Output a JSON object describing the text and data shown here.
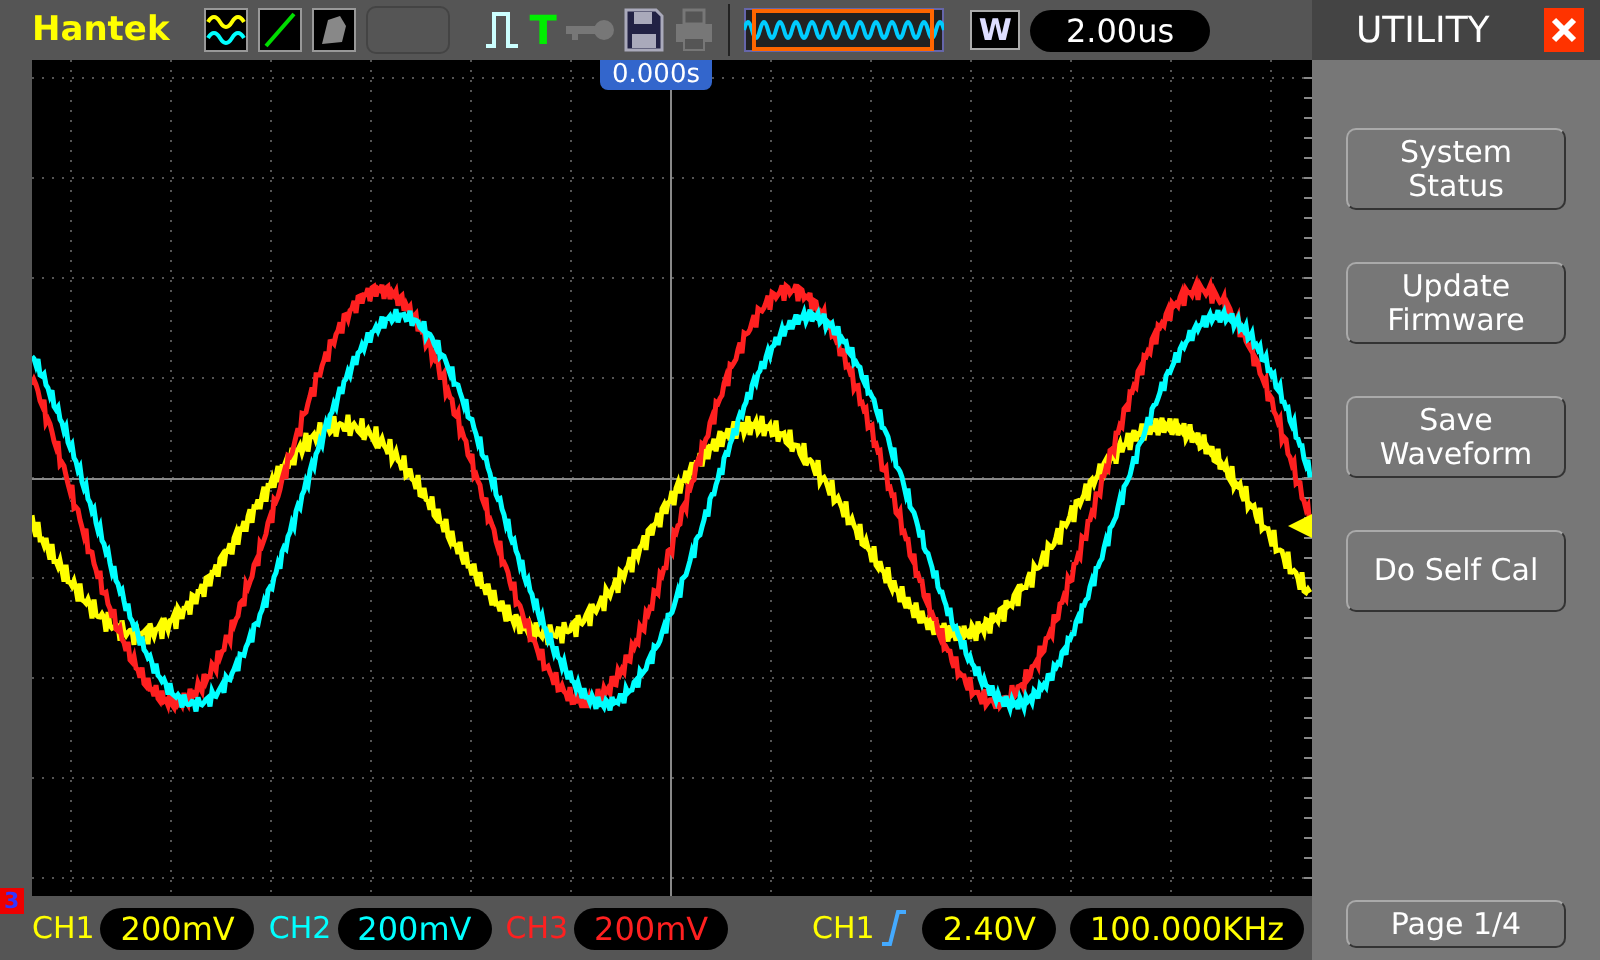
{
  "header": {
    "brand": "Hantek",
    "trigger_status": "T",
    "window_label": "W",
    "timebase": "2.00us"
  },
  "screen": {
    "time_offset": "0.000s"
  },
  "menu": {
    "title": "UTILITY",
    "items": [
      {
        "label": "System Status"
      },
      {
        "label": "Update Firmware"
      },
      {
        "label": "Save Waveform"
      },
      {
        "label": "Do Self Cal"
      }
    ],
    "page": "Page 1/4"
  },
  "channels": [
    {
      "label": "CH1",
      "scale": "200mV",
      "color": "#ffff00"
    },
    {
      "label": "CH2",
      "scale": "200mV",
      "color": "#00ffff"
    },
    {
      "label": "CH3",
      "scale": "200mV",
      "color": "#ff2020"
    }
  ],
  "ref_marker": "3",
  "trigger": {
    "source": "CH1",
    "level": "2.40V",
    "frequency": "100.000KHz"
  }
}
